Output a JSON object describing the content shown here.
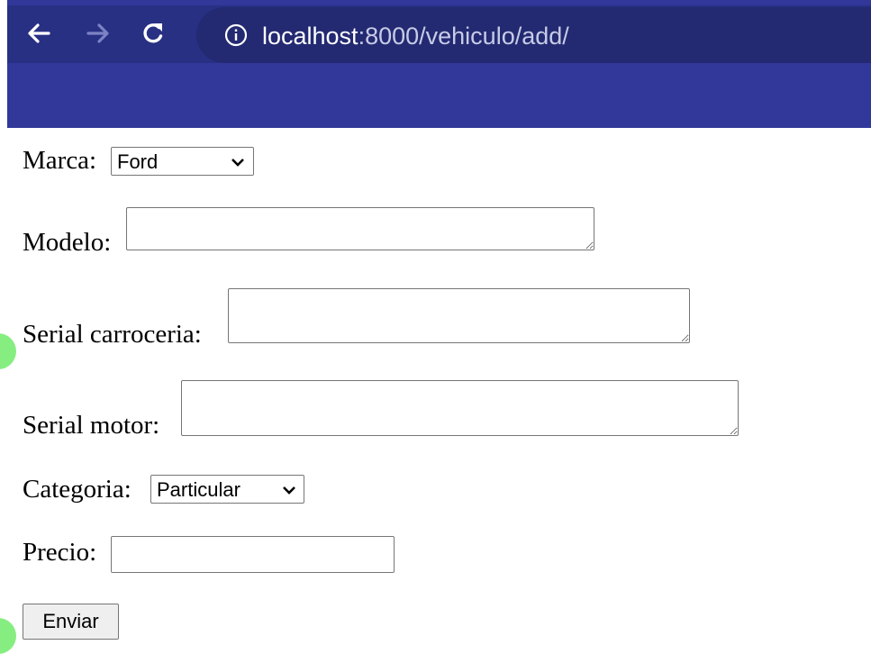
{
  "browser": {
    "url_host": "localhost",
    "url_rest": ":8000/vehiculo/add/",
    "icons": {
      "back": "arrow-left-icon",
      "forward": "arrow-right-icon",
      "reload": "reload-icon",
      "info": "info-icon"
    },
    "colors": {
      "chrome": "#32379a",
      "toolbar": "#283084",
      "omnibox": "#232a72"
    }
  },
  "form": {
    "marca": {
      "label": "Marca:",
      "selected": "Ford"
    },
    "modelo": {
      "label": "Modelo:",
      "value": ""
    },
    "serial_carroceria": {
      "label": "Serial carroceria:",
      "value": ""
    },
    "serial_motor": {
      "label": "Serial motor:",
      "value": ""
    },
    "categoria": {
      "label": "Categoria:",
      "selected": "Particular"
    },
    "precio": {
      "label": "Precio:",
      "value": ""
    },
    "submit_label": "Enviar"
  }
}
